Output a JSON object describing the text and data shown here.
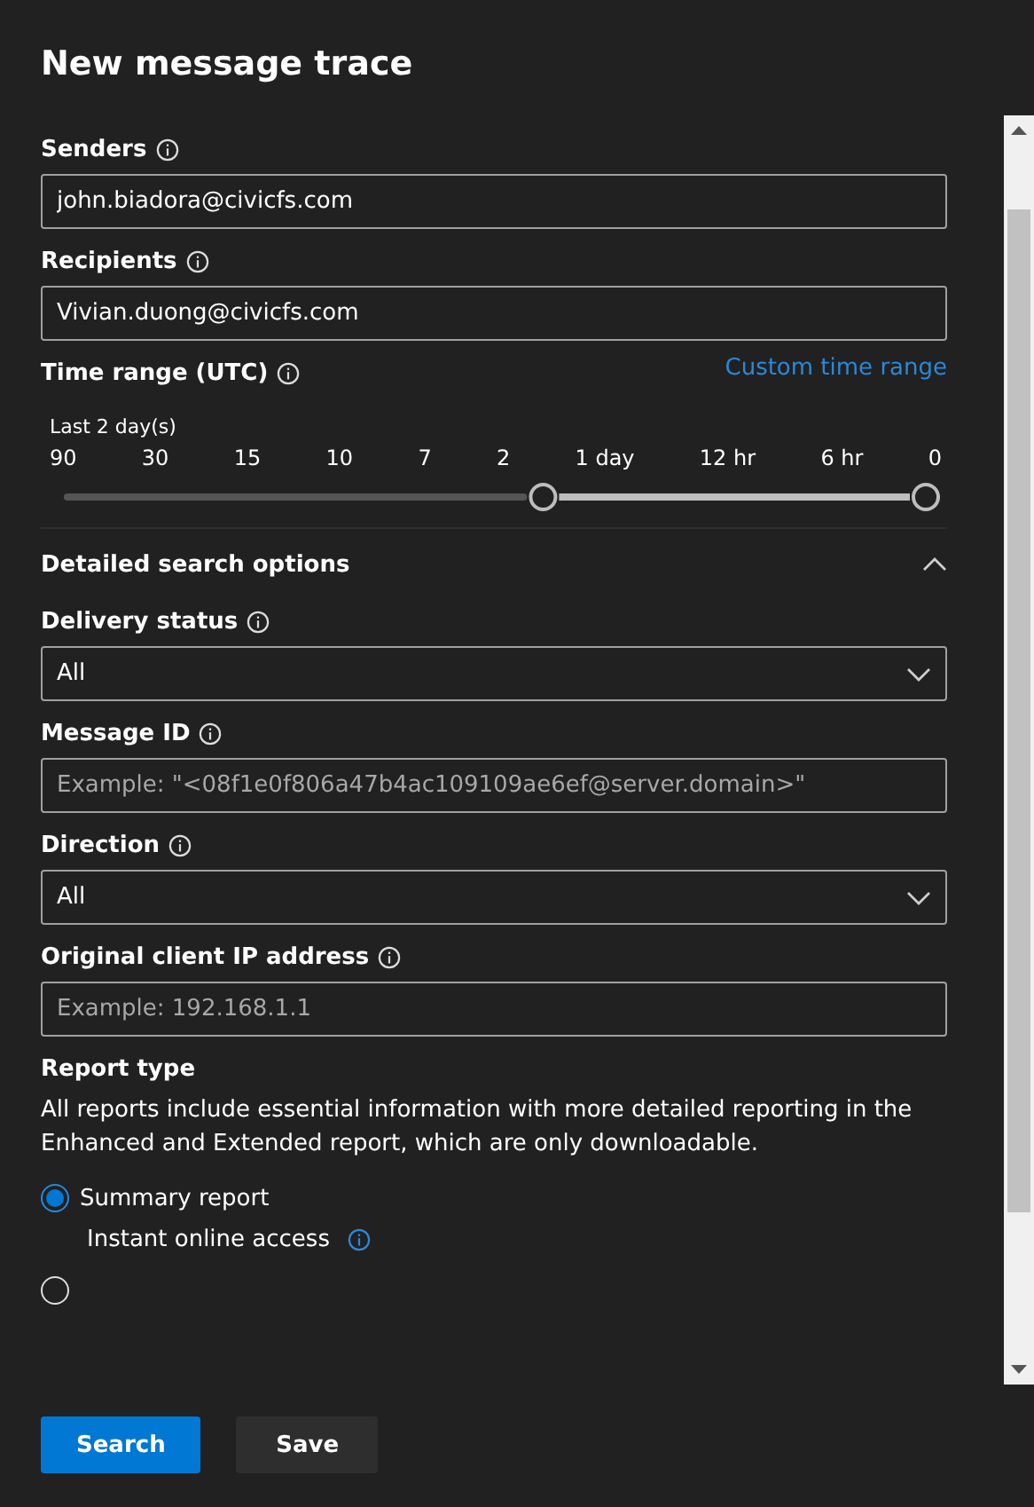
{
  "title": "New message trace",
  "senders": {
    "label": "Senders",
    "value": "john.biadora@civicfs.com"
  },
  "recipients": {
    "label": "Recipients",
    "value": "Vivian.duong@civicfs.com"
  },
  "time_range": {
    "label": "Time range (UTC)",
    "link": "Custom time range",
    "caption": "Last 2 day(s)",
    "ticks": [
      "90",
      "30",
      "15",
      "10",
      "7",
      "2",
      "1 day",
      "12 hr",
      "6 hr",
      "0"
    ],
    "thumbs": [
      {
        "level": 0.556
      },
      {
        "level": 1
      }
    ]
  },
  "detailed": {
    "label": "Detailed search options",
    "expanded": true
  },
  "fields": [
    {
      "kind": "dropdown",
      "label": "Delivery status",
      "value": "All"
    },
    {
      "kind": "text",
      "label": "Message ID",
      "placeholder": "Example: \"<08f1e0f806a47b4ac109109ae6ef@server.domain>\""
    },
    {
      "kind": "dropdown",
      "label": "Direction",
      "value": "All"
    },
    {
      "kind": "text",
      "label": "Original client IP address",
      "placeholder": "Example: 192.168.1.1"
    }
  ],
  "report_type": {
    "label": "Report type",
    "description": "All reports include essential information with more detailed reporting in the Enhanced and Extended report, which are only downloadable.",
    "options": [
      {
        "label": "Summary report",
        "note": "Instant online access",
        "selected": true
      },
      {
        "selected": false
      }
    ]
  },
  "buttons": [
    {
      "label": "Search",
      "kind": "primary"
    },
    {
      "label": "Save",
      "kind": "secondary"
    }
  ]
}
